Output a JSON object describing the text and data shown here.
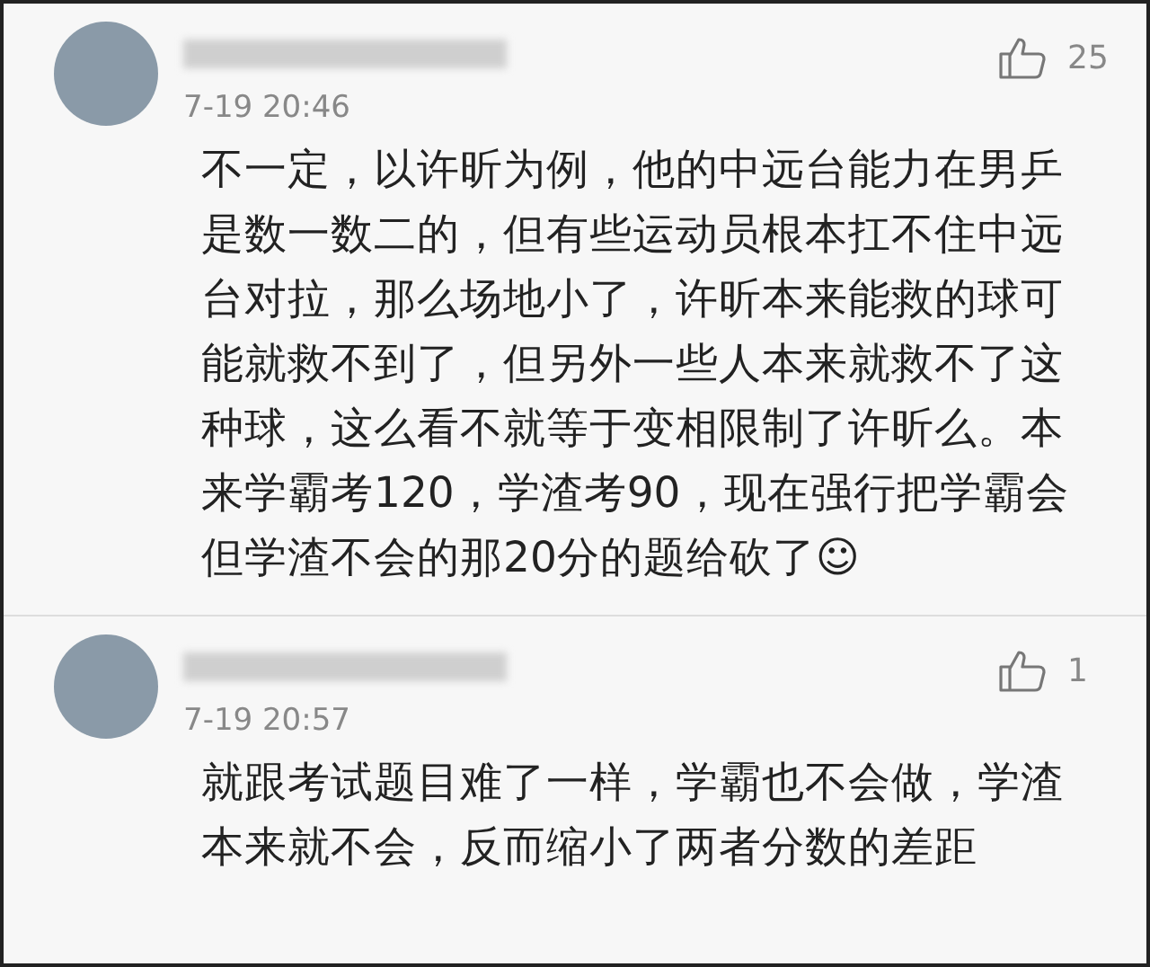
{
  "comments": [
    {
      "time": "7-19 20:46",
      "likes": "25",
      "text": "不一定，以许昕为例，他的中远台能力在男乒是数一数二的，但有些运动员根本扛不住中远台对拉，那么场地小了，许昕本来能救的球可能就救不到了，但另外一些人本来就救不了这种球，这么看不就等于变相限制了许昕么。本来学霸考120，学渣考90，现在强行把学霸会但学渣不会的那20分的题给砍了☺"
    },
    {
      "time": "7-19 20:57",
      "likes": "1",
      "text": "就跟考试题目难了一样，学霸也不会做，学渣本来就不会，反而缩小了两者分数的差距"
    }
  ]
}
